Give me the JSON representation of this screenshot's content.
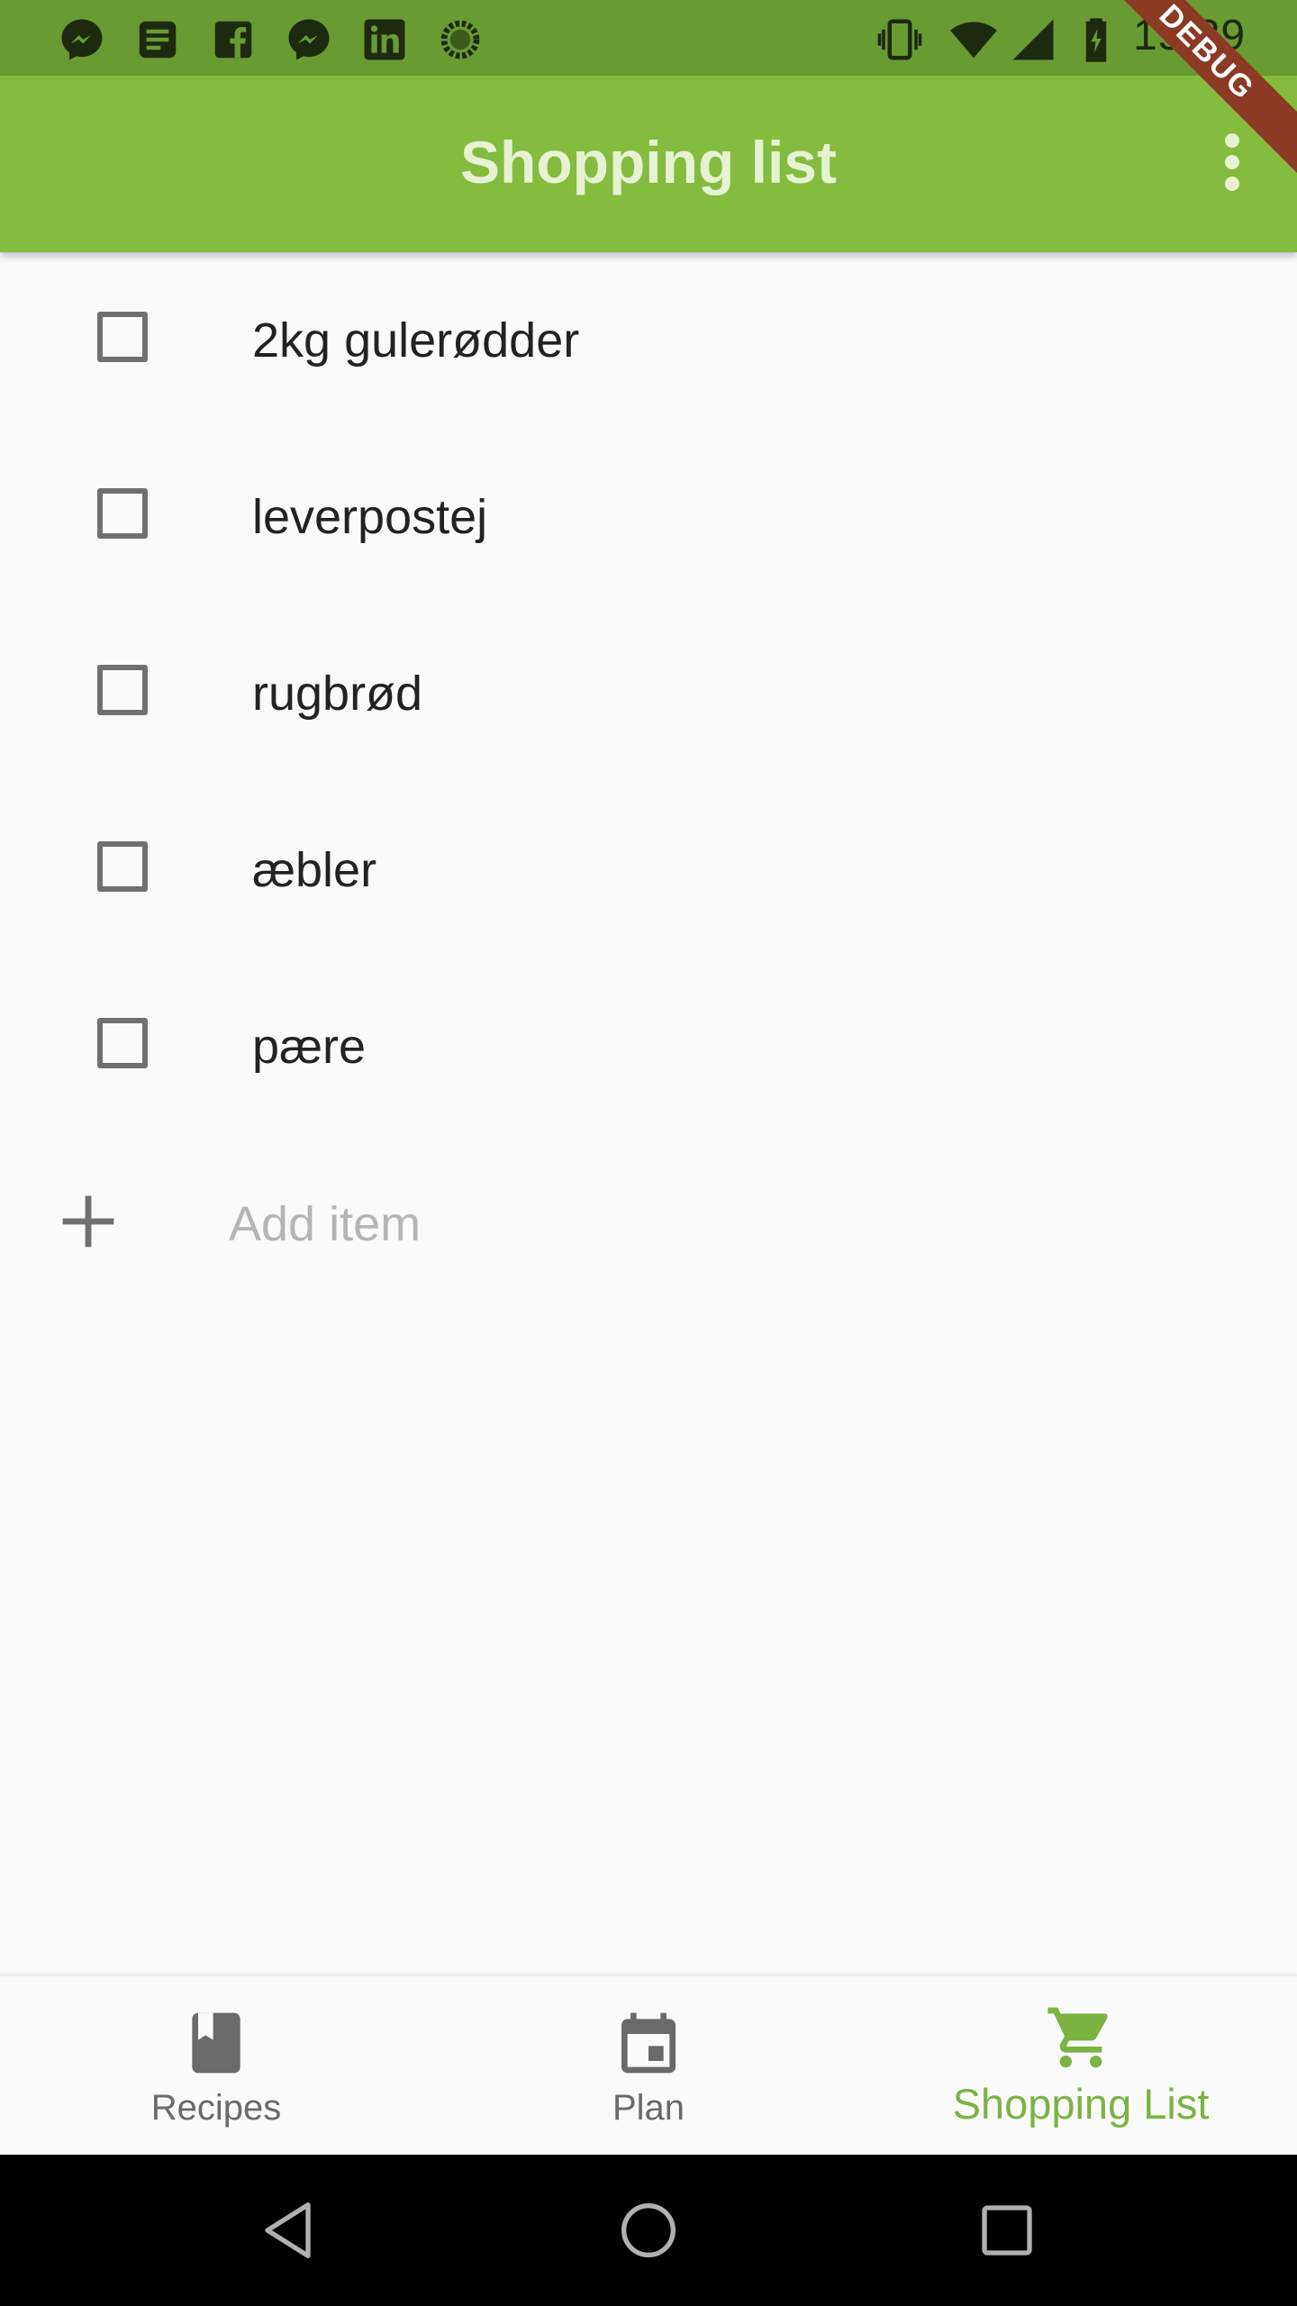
{
  "status_bar": {
    "time": "15:29",
    "left_icons": [
      "messenger-icon",
      "news-icon",
      "facebook-icon",
      "messenger-icon",
      "linkedin-icon",
      "loading-icon"
    ],
    "right_icons": [
      "vibrate-icon",
      "wifi-icon",
      "signal-icon",
      "battery-charging-icon"
    ]
  },
  "app_bar": {
    "title": "Shopping list",
    "menu_icon": "more-vert-icon"
  },
  "debug_banner": "DEBUG",
  "shopping_items": [
    {
      "label": "2kg gulerødder",
      "checked": false
    },
    {
      "label": "leverpostej",
      "checked": false
    },
    {
      "label": "rugbrød",
      "checked": false
    },
    {
      "label": "æbler",
      "checked": false
    },
    {
      "label": "pære",
      "checked": false
    }
  ],
  "add_item": {
    "icon": "plus-icon",
    "placeholder": "Add item"
  },
  "bottom_nav": {
    "items": [
      {
        "label": "Recipes",
        "icon": "book-icon",
        "active": false
      },
      {
        "label": "Plan",
        "icon": "calendar-icon",
        "active": false
      },
      {
        "label": "Shopping List",
        "icon": "cart-icon",
        "active": true
      }
    ]
  },
  "colors": {
    "status_bar": "#6a9a32",
    "app_bar": "#85bb3e",
    "title_text": "#e6f2d2",
    "accent": "#7cb342",
    "inactive": "#6a6a6a",
    "debug_ribbon": "#8b3a24"
  }
}
